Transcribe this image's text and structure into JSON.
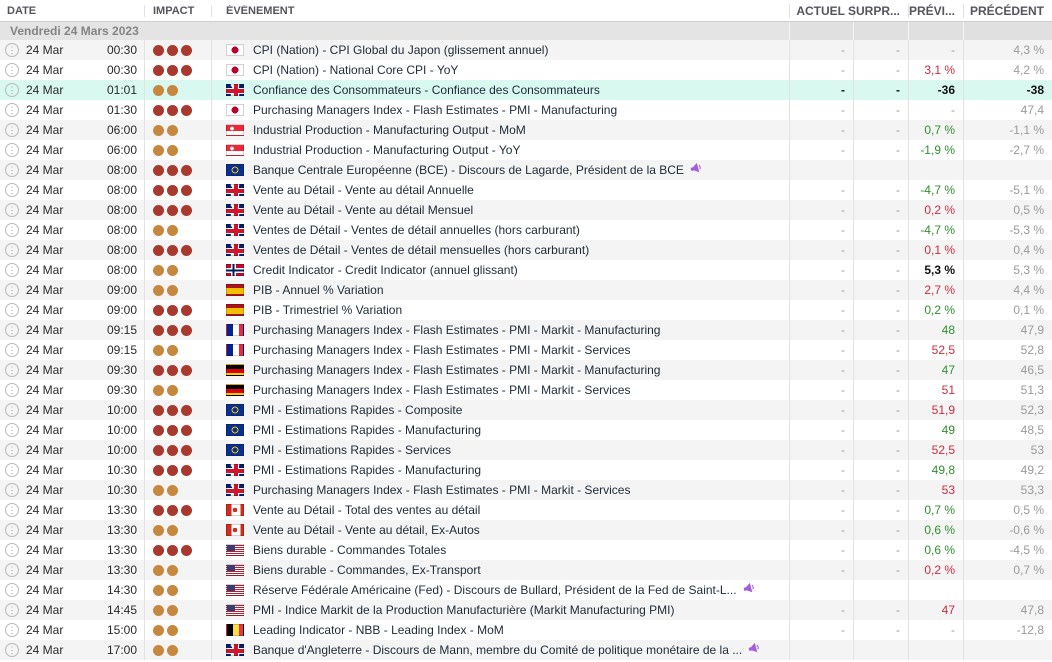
{
  "header": {
    "date": "DATE",
    "impact": "IMPACT",
    "event": "ÉVÉNEMENT",
    "actual": "ACTUEL",
    "surprise": "SURPR...",
    "forecast": "PRÉVI...",
    "previous": "PRÉCÉDENT"
  },
  "date_group": "Vendredi 24 Mars 2023",
  "icons": {
    "info_glyph": "⋮",
    "speech_icon": "megaphone-icon"
  },
  "colors": {
    "impact_high": "#a8392e",
    "impact_medium": "#c6873e",
    "forecast_green": "#2f8f2f",
    "forecast_red": "#cc2b3f",
    "highlight_row": "#d9f8ef",
    "speech_icon": "#a45ddc"
  },
  "rows": [
    {
      "date": "24 Mar",
      "time": "00:30",
      "impact": "high",
      "flag": "jp",
      "event": "CPI (Nation) - CPI Global du Japon (glissement annuel)",
      "speech": false,
      "actual": "-",
      "surprise": "-",
      "forecast": "-",
      "forecast_style": "",
      "previous": "4,3 %",
      "highlight": false
    },
    {
      "date": "24 Mar",
      "time": "00:30",
      "impact": "high",
      "flag": "jp",
      "event": "CPI (Nation) - National Core CPI - YoY",
      "speech": false,
      "actual": "-",
      "surprise": "-",
      "forecast": "3,1 %",
      "forecast_style": "red",
      "previous": "4,2 %",
      "highlight": false
    },
    {
      "date": "24 Mar",
      "time": "01:01",
      "impact": "medium",
      "flag": "gb",
      "event": "Confiance des Consommateurs - Confiance des Consommateurs",
      "speech": false,
      "actual": "-",
      "surprise": "-",
      "forecast": "-36",
      "forecast_style": "dark",
      "previous": "-38",
      "highlight": true
    },
    {
      "date": "24 Mar",
      "time": "01:30",
      "impact": "high",
      "flag": "jp",
      "event": "Purchasing Managers Index - Flash Estimates - PMI - Manufacturing",
      "speech": false,
      "actual": "-",
      "surprise": "-",
      "forecast": "-",
      "forecast_style": "",
      "previous": "47,4",
      "highlight": false
    },
    {
      "date": "24 Mar",
      "time": "06:00",
      "impact": "medium",
      "flag": "sg",
      "event": "Industrial Production - Manufacturing Output - MoM",
      "speech": false,
      "actual": "-",
      "surprise": "-",
      "forecast": "0,7 %",
      "forecast_style": "green",
      "previous": "-1,1 %",
      "highlight": false
    },
    {
      "date": "24 Mar",
      "time": "06:00",
      "impact": "medium",
      "flag": "sg",
      "event": "Industrial Production - Manufacturing Output - YoY",
      "speech": false,
      "actual": "-",
      "surprise": "-",
      "forecast": "-1,9 %",
      "forecast_style": "green",
      "previous": "-2,7 %",
      "highlight": false
    },
    {
      "date": "24 Mar",
      "time": "08:00",
      "impact": "high",
      "flag": "eu",
      "event": "Banque Centrale Européenne (BCE) - Discours de Lagarde, Président de la BCE",
      "speech": true,
      "actual": "",
      "surprise": "",
      "forecast": "",
      "forecast_style": "",
      "previous": "",
      "highlight": false
    },
    {
      "date": "24 Mar",
      "time": "08:00",
      "impact": "high",
      "flag": "gb",
      "event": "Vente au Détail - Vente au détail Annuelle",
      "speech": false,
      "actual": "-",
      "surprise": "-",
      "forecast": "-4,7 %",
      "forecast_style": "green",
      "previous": "-5,1 %",
      "highlight": false
    },
    {
      "date": "24 Mar",
      "time": "08:00",
      "impact": "high",
      "flag": "gb",
      "event": "Vente au Détail - Vente au détail Mensuel",
      "speech": false,
      "actual": "-",
      "surprise": "-",
      "forecast": "0,2 %",
      "forecast_style": "red",
      "previous": "0,5 %",
      "highlight": false
    },
    {
      "date": "24 Mar",
      "time": "08:00",
      "impact": "medium",
      "flag": "gb",
      "event": "Ventes de Détail - Ventes de détail annuelles (hors carburant)",
      "speech": false,
      "actual": "-",
      "surprise": "-",
      "forecast": "-4,7 %",
      "forecast_style": "green",
      "previous": "-5,3 %",
      "highlight": false
    },
    {
      "date": "24 Mar",
      "time": "08:00",
      "impact": "high",
      "flag": "gb",
      "event": "Ventes de Détail - Ventes de détail mensuelles (hors carburant)",
      "speech": false,
      "actual": "-",
      "surprise": "-",
      "forecast": "0,1 %",
      "forecast_style": "red",
      "previous": "0,4 %",
      "highlight": false
    },
    {
      "date": "24 Mar",
      "time": "08:00",
      "impact": "medium",
      "flag": "no",
      "event": "Credit Indicator - Credit Indicator (annuel glissant)",
      "speech": false,
      "actual": "-",
      "surprise": "-",
      "forecast": "5,3 %",
      "forecast_style": "dark",
      "previous": "5,3 %",
      "highlight": false
    },
    {
      "date": "24 Mar",
      "time": "09:00",
      "impact": "medium",
      "flag": "es",
      "event": "PIB - Annuel % Variation",
      "speech": false,
      "actual": "-",
      "surprise": "-",
      "forecast": "2,7 %",
      "forecast_style": "red",
      "previous": "4,4 %",
      "highlight": false
    },
    {
      "date": "24 Mar",
      "time": "09:00",
      "impact": "high",
      "flag": "es",
      "event": "PIB - Trimestriel % Variation",
      "speech": false,
      "actual": "-",
      "surprise": "-",
      "forecast": "0,2 %",
      "forecast_style": "green",
      "previous": "0,1 %",
      "highlight": false
    },
    {
      "date": "24 Mar",
      "time": "09:15",
      "impact": "high",
      "flag": "fr",
      "event": "Purchasing Managers Index - Flash Estimates - PMI - Markit - Manufacturing",
      "speech": false,
      "actual": "-",
      "surprise": "-",
      "forecast": "48",
      "forecast_style": "green",
      "previous": "47,9",
      "highlight": false
    },
    {
      "date": "24 Mar",
      "time": "09:15",
      "impact": "medium",
      "flag": "fr",
      "event": "Purchasing Managers Index - Flash Estimates - PMI - Markit - Services",
      "speech": false,
      "actual": "-",
      "surprise": "-",
      "forecast": "52,5",
      "forecast_style": "red",
      "previous": "52,8",
      "highlight": false
    },
    {
      "date": "24 Mar",
      "time": "09:30",
      "impact": "high",
      "flag": "de",
      "event": "Purchasing Managers Index - Flash Estimates - PMI - Markit - Manufacturing",
      "speech": false,
      "actual": "-",
      "surprise": "-",
      "forecast": "47",
      "forecast_style": "green",
      "previous": "46,5",
      "highlight": false
    },
    {
      "date": "24 Mar",
      "time": "09:30",
      "impact": "medium",
      "flag": "de",
      "event": "Purchasing Managers Index - Flash Estimates - PMI - Markit - Services",
      "speech": false,
      "actual": "-",
      "surprise": "-",
      "forecast": "51",
      "forecast_style": "red",
      "previous": "51,3",
      "highlight": false
    },
    {
      "date": "24 Mar",
      "time": "10:00",
      "impact": "high",
      "flag": "eu",
      "event": "PMI - Estimations Rapides - Composite",
      "speech": false,
      "actual": "-",
      "surprise": "-",
      "forecast": "51,9",
      "forecast_style": "red",
      "previous": "52,3",
      "highlight": false
    },
    {
      "date": "24 Mar",
      "time": "10:00",
      "impact": "high",
      "flag": "eu",
      "event": "PMI - Estimations Rapides - Manufacturing",
      "speech": false,
      "actual": "-",
      "surprise": "-",
      "forecast": "49",
      "forecast_style": "green",
      "previous": "48,5",
      "highlight": false
    },
    {
      "date": "24 Mar",
      "time": "10:00",
      "impact": "high",
      "flag": "eu",
      "event": "PMI - Estimations Rapides - Services",
      "speech": false,
      "actual": "-",
      "surprise": "-",
      "forecast": "52,5",
      "forecast_style": "red",
      "previous": "53",
      "highlight": false
    },
    {
      "date": "24 Mar",
      "time": "10:30",
      "impact": "high",
      "flag": "gb",
      "event": "PMI - Estimations Rapides - Manufacturing",
      "speech": false,
      "actual": "-",
      "surprise": "-",
      "forecast": "49,8",
      "forecast_style": "green",
      "previous": "49,2",
      "highlight": false
    },
    {
      "date": "24 Mar",
      "time": "10:30",
      "impact": "medium",
      "flag": "gb",
      "event": "Purchasing Managers Index - Flash Estimates - PMI - Markit - Services",
      "speech": false,
      "actual": "-",
      "surprise": "-",
      "forecast": "53",
      "forecast_style": "red",
      "previous": "53,3",
      "highlight": false
    },
    {
      "date": "24 Mar",
      "time": "13:30",
      "impact": "high",
      "flag": "ca",
      "event": "Vente au Détail - Total des ventes au détail",
      "speech": false,
      "actual": "-",
      "surprise": "-",
      "forecast": "0,7 %",
      "forecast_style": "green",
      "previous": "0,5 %",
      "highlight": false
    },
    {
      "date": "24 Mar",
      "time": "13:30",
      "impact": "medium",
      "flag": "ca",
      "event": "Vente au Détail - Vente au détail, Ex-Autos",
      "speech": false,
      "actual": "-",
      "surprise": "-",
      "forecast": "0,6 %",
      "forecast_style": "green",
      "previous": "-0,6 %",
      "highlight": false
    },
    {
      "date": "24 Mar",
      "time": "13:30",
      "impact": "high",
      "flag": "us",
      "event": "Biens durable - Commandes Totales",
      "speech": false,
      "actual": "-",
      "surprise": "-",
      "forecast": "0,6 %",
      "forecast_style": "green",
      "previous": "-4,5 %",
      "highlight": false
    },
    {
      "date": "24 Mar",
      "time": "13:30",
      "impact": "medium",
      "flag": "us",
      "event": "Biens durable - Commandes, Ex-Transport",
      "speech": false,
      "actual": "-",
      "surprise": "-",
      "forecast": "0,2 %",
      "forecast_style": "red",
      "previous": "0,7 %",
      "highlight": false
    },
    {
      "date": "24 Mar",
      "time": "14:30",
      "impact": "medium",
      "flag": "us",
      "event": "Réserve Fédérale Américaine (Fed) - Discours de Bullard, Président de la Fed de Saint-L...",
      "speech": true,
      "actual": "",
      "surprise": "",
      "forecast": "",
      "forecast_style": "",
      "previous": "",
      "highlight": false
    },
    {
      "date": "24 Mar",
      "time": "14:45",
      "impact": "medium",
      "flag": "us",
      "event": "PMI - Indice Markit de la Production Manufacturière (Markit Manufacturing PMI)",
      "speech": false,
      "actual": "-",
      "surprise": "-",
      "forecast": "47",
      "forecast_style": "red",
      "previous": "47,8",
      "highlight": false
    },
    {
      "date": "24 Mar",
      "time": "15:00",
      "impact": "medium",
      "flag": "be",
      "event": "Leading Indicator - NBB - Leading Index - MoM",
      "speech": false,
      "actual": "-",
      "surprise": "-",
      "forecast": "-",
      "forecast_style": "",
      "previous": "-12,8",
      "highlight": false
    },
    {
      "date": "24 Mar",
      "time": "17:00",
      "impact": "medium",
      "flag": "gb",
      "event": "Banque d'Angleterre - Discours de Mann, membre du Comité de politique monétaire de la ...",
      "speech": true,
      "actual": "",
      "surprise": "",
      "forecast": "",
      "forecast_style": "",
      "previous": "",
      "highlight": false
    }
  ]
}
